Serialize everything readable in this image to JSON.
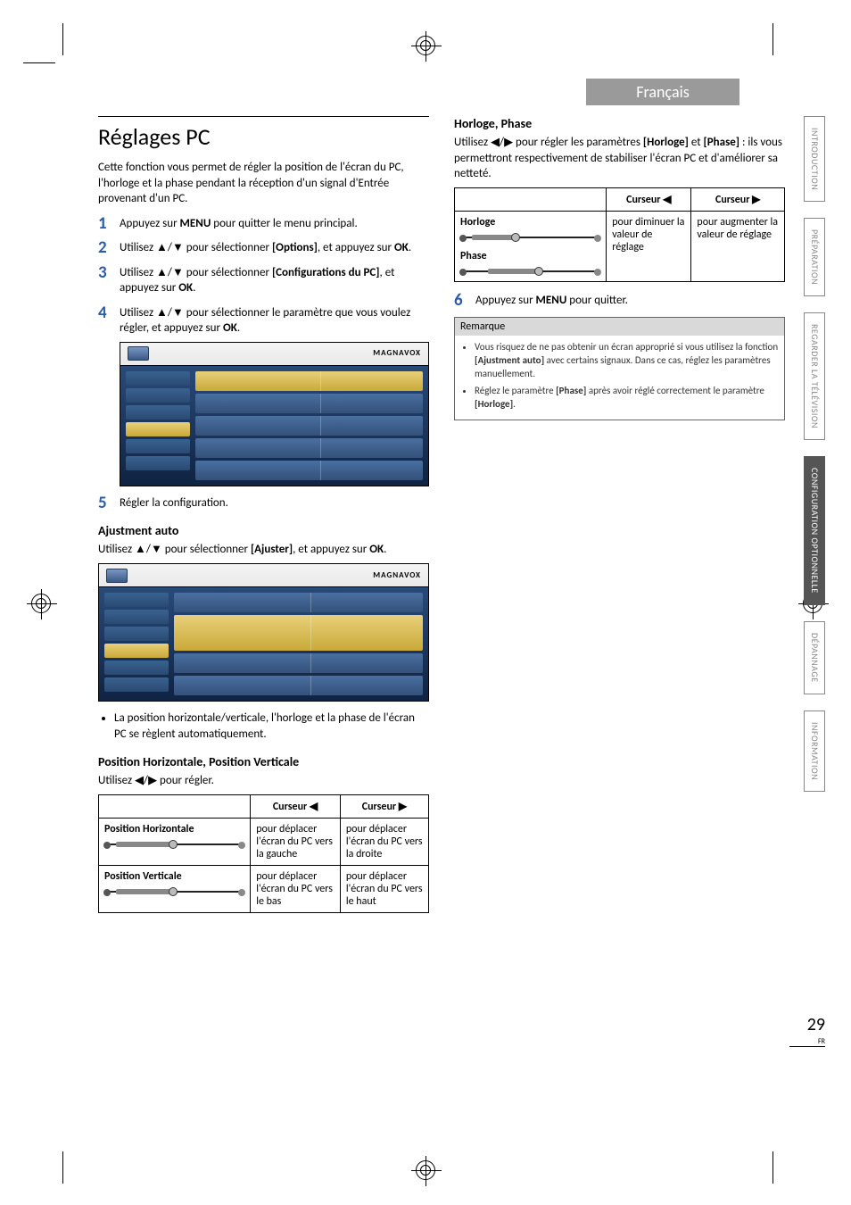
{
  "lang_tab": "Français",
  "title": "Réglages PC",
  "intro": "Cette fonction vous permet de régler la position de l'écran du PC, l'horloge et la phase pendant la réception d'un signal d'Entrée provenant d'un PC.",
  "steps": {
    "s1": {
      "pre": "Appuyez sur ",
      "b1": "MENU",
      "post": " pour quitter le menu principal."
    },
    "s2": {
      "pre": "Utilisez ▲/▼ pour sélectionner ",
      "b1": "[Options]",
      "mid": ", et appuyez sur ",
      "b2": "OK",
      "post": "."
    },
    "s3": {
      "pre": "Utilisez ▲/▼ pour sélectionner ",
      "b1": "[Configurations du PC]",
      "mid": ", et appuyez sur ",
      "b2": "OK",
      "post": "."
    },
    "s4": {
      "pre": "Utilisez ▲/▼ pour sélectionner le paramètre que vous voulez régler, et appuyez sur ",
      "b1": "OK",
      "post": "."
    },
    "s5": "Régler la configuration.",
    "s6": {
      "pre": "Appuyez sur ",
      "b1": "MENU",
      "post": " pour quitter."
    }
  },
  "ajust": {
    "heading": "Ajustment auto",
    "text_pre": "Utilisez ▲/▼ pour sélectionner ",
    "text_b1": "[Ajuster]",
    "text_mid": ", et appuyez sur ",
    "text_b2": "OK",
    "text_post": ".",
    "bullet": "La position horizontale/verticale, l'horloge et la phase de l'écran PC se règlent automatiquement."
  },
  "pos": {
    "heading": "Position Horizontale, Position Verticale",
    "text": "Utilisez ◀/▶ pour régler.",
    "col_left": "Curseur ◀",
    "col_right": "Curseur ▶",
    "row1_label": "Position Horizontale",
    "row1_left": "pour déplacer l'écran du PC vers la gauche",
    "row1_right": "pour déplacer l'écran du PC vers la droite",
    "row2_label": "Position Verticale",
    "row2_left": "pour déplacer l'écran du PC vers le bas",
    "row2_right": "pour déplacer l'écran du PC vers le haut"
  },
  "hp": {
    "heading": "Horloge, Phase",
    "text_pre": "Utilisez ◀/▶ pour régler les paramètres ",
    "text_b1": "[Horloge]",
    "text_mid1": " et ",
    "text_b2": "[Phase]",
    "text_post": " : ils vous permettront respectivement de stabiliser l'écran PC et d'améliorer sa netteté.",
    "col_left": "Curseur ◀",
    "col_right": "Curseur ▶",
    "row1_label": "Horloge",
    "row2_label": "Phase",
    "cell_left": "pour diminuer la valeur de réglage",
    "cell_right": "pour augmenter la valeur de réglage"
  },
  "remarque": {
    "title": "Remarque",
    "li1_pre": "Vous risquez de ne pas obtenir un écran approprié si vous utilisez la fonction ",
    "li1_b": "[Ajustment auto]",
    "li1_post": " avec certains signaux. Dans ce cas, réglez les paramètres manuellement.",
    "li2_pre": "Réglez le paramètre ",
    "li2_b1": "[Phase]",
    "li2_mid": " après avoir réglé correctement le paramètre ",
    "li2_b2": "[Horloge]",
    "li2_post": "."
  },
  "side_tabs": {
    "t1": "INTRODUCTION",
    "t2": "PRÉPARATION",
    "t3": "REGARDER LA TÉLÉVISION",
    "t4": "CONFIGURATION OPTIONNELLE",
    "t5": "DÉPANNAGE",
    "t6": "INFORMATION"
  },
  "osd_brand": "MAGNAVOX",
  "page_number": "29",
  "page_lang": "FR"
}
